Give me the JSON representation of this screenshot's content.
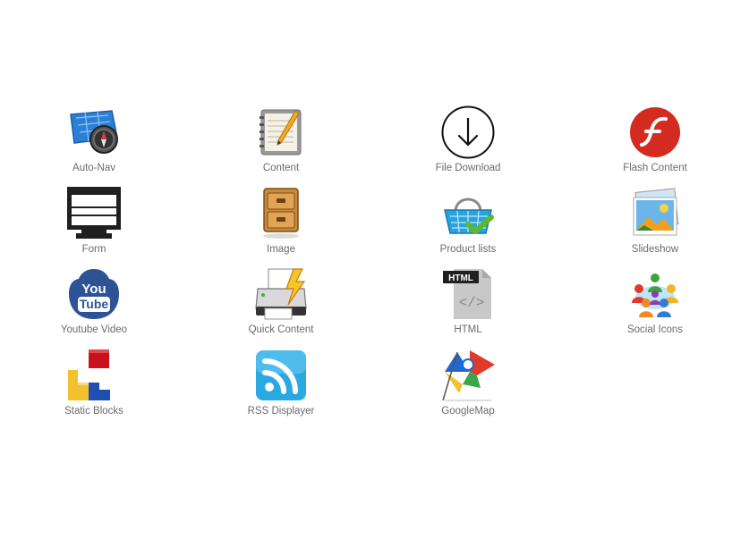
{
  "blocks": [
    {
      "label": "Auto-Nav",
      "icon": "auto-nav-map-compass-icon"
    },
    {
      "label": "Content",
      "icon": "notepad-pencil-icon"
    },
    {
      "label": "File Download",
      "icon": "download-arrow-circle-icon"
    },
    {
      "label": "Flash Content",
      "icon": "adobe-flash-icon"
    },
    {
      "label": "Form",
      "icon": "monitor-form-icon"
    },
    {
      "label": "Image",
      "icon": "filing-cabinet-icon"
    },
    {
      "label": "Product lists",
      "icon": "shopping-basket-check-icon"
    },
    {
      "label": "Slideshow",
      "icon": "photo-stack-icon"
    },
    {
      "label": "Youtube Video",
      "icon": "youtube-icon"
    },
    {
      "label": "Quick Content",
      "icon": "printer-lightning-icon"
    },
    {
      "label": "HTML",
      "icon": "html-file-icon"
    },
    {
      "label": "Social Icons",
      "icon": "social-people-icon"
    },
    {
      "label": "Static Blocks",
      "icon": "colored-blocks-icon"
    },
    {
      "label": "RSS Displayer",
      "icon": "rss-icon"
    },
    {
      "label": "GoogleMap",
      "icon": "google-map-pin-icon"
    }
  ],
  "colors": {
    "label_text": "#6b6b6b",
    "flash_red": "#d42b20",
    "youtube_blue": "#2e5395",
    "rss_blue": "#29a9e0"
  }
}
